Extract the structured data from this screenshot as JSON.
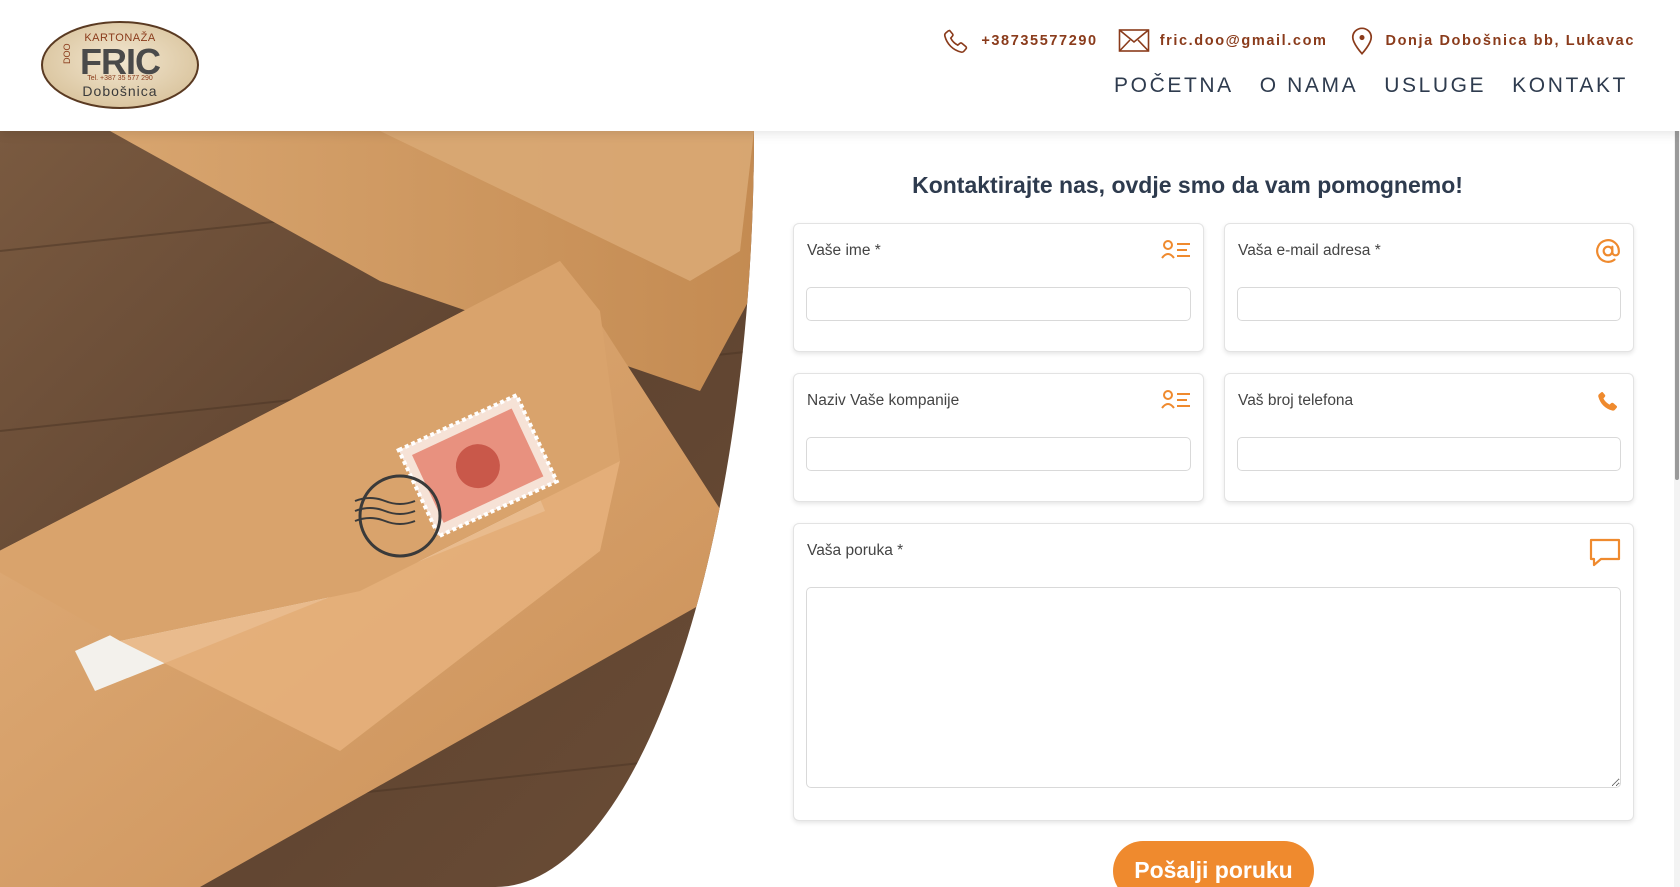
{
  "header": {
    "logo": {
      "top_text": "KARTONAŽA",
      "brand": "FRIC",
      "side_text": "DOO",
      "tel_text": "Tel. +387 35 577 290",
      "place": "Dobošnica"
    },
    "contacts": [
      {
        "icon": "phone-icon",
        "text": "+38735577290"
      },
      {
        "icon": "mail-icon",
        "text": "fric.doo@gmail.com"
      },
      {
        "icon": "location-pin-icon",
        "text": "Donja Dobošnica bb, Lukavac"
      }
    ],
    "nav": [
      {
        "label": "POČETNA"
      },
      {
        "label": "O NAMA"
      },
      {
        "label": "USLUGE"
      },
      {
        "label": "KONTAKT"
      }
    ]
  },
  "form": {
    "title": "Kontaktirajte nas, ovdje smo da vam pomognemo!",
    "fields": [
      {
        "label": "Vaše ime *",
        "icon": "person-list-icon",
        "value": ""
      },
      {
        "label": "Vaša e-mail adresa *",
        "icon": "at-sign-icon",
        "value": ""
      },
      {
        "label": "Naziv Vaše kompanije",
        "icon": "person-list-icon",
        "value": ""
      },
      {
        "label": "Vaš broj telefona",
        "icon": "phone-icon",
        "value": ""
      },
      {
        "label": "Vaša poruka *",
        "icon": "message-icon",
        "value": ""
      }
    ],
    "submit_label": "Pošalji poruku"
  },
  "colors": {
    "accent_orange": "#ef8a2e",
    "brand_brown": "#8a3b1b",
    "heading_navy": "#2e3b4e"
  }
}
